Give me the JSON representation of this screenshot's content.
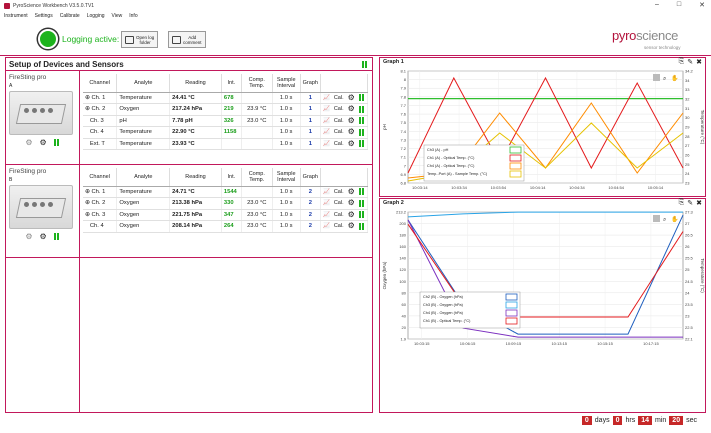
{
  "window": {
    "title": "PyroScience Workbench V3.5.0.TV1",
    "controls": [
      "–",
      "□",
      "✕"
    ]
  },
  "menu": [
    "Instrument",
    "Settings",
    "Calibrate",
    "Logging",
    "View",
    "Info"
  ],
  "logging": {
    "status_text": "Logging active:",
    "open_folder": [
      "Open log",
      "folder"
    ],
    "add_comment": [
      "Add",
      "comment"
    ]
  },
  "brand": {
    "name_a": "pyro",
    "name_b": "science",
    "tagline": "sensor technology",
    "color": "#b3123b"
  },
  "setup": {
    "title": "Setup of Devices and Sensors",
    "columns": [
      "Channel",
      "Analyte",
      "Reading",
      "Int.",
      "Comp. Temp.",
      "Sample Interval",
      "Graph"
    ],
    "devices": [
      {
        "name": "FireSting pro",
        "letter": "A",
        "rows": [
          {
            "channel": "Ch. 1",
            "expand": true,
            "analyte": "Temperature",
            "reading": "24.41 °C",
            "int": "678",
            "comp": "",
            "interval": "1.0 s",
            "graph": "1"
          },
          {
            "channel": "Ch. 2",
            "expand": true,
            "analyte": "Oxygen",
            "reading": "217.24 hPa",
            "int": "219",
            "comp": "23.9 °C",
            "interval": "1.0 s",
            "graph": "1"
          },
          {
            "channel": "Ch. 3",
            "expand": false,
            "analyte": "pH",
            "reading": "7.78 pH",
            "int": "326",
            "comp": "23.0 °C",
            "interval": "1.0 s",
            "graph": "1"
          },
          {
            "channel": "Ch. 4",
            "expand": false,
            "analyte": "Temperature",
            "reading": "22.90 °C",
            "int": "1158",
            "comp": "",
            "interval": "1.0 s",
            "graph": "1"
          },
          {
            "channel": "Ext. T",
            "expand": false,
            "analyte": "Temperature",
            "reading": "23.93 °C",
            "int": "",
            "comp": "",
            "interval": "1.0 s",
            "graph": "1"
          }
        ]
      },
      {
        "name": "FireSting pro",
        "letter": "B",
        "rows": [
          {
            "channel": "Ch. 1",
            "expand": true,
            "analyte": "Temperature",
            "reading": "24.71 °C",
            "int": "1544",
            "comp": "",
            "interval": "1.0 s",
            "graph": "2"
          },
          {
            "channel": "Ch. 2",
            "expand": true,
            "analyte": "Oxygen",
            "reading": "213.38 hPa",
            "int": "330",
            "comp": "23.0 °C",
            "interval": "1.0 s",
            "graph": "2"
          },
          {
            "channel": "Ch. 3",
            "expand": true,
            "analyte": "Oxygen",
            "reading": "221.75 hPa",
            "int": "347",
            "comp": "23.0 °C",
            "interval": "1.0 s",
            "graph": "2"
          },
          {
            "channel": "Ch. 4",
            "expand": false,
            "analyte": "Oxygen",
            "reading": "208.14 hPa",
            "int": "264",
            "comp": "23.0 °C",
            "interval": "1.0 s",
            "graph": "2"
          }
        ]
      }
    ],
    "cal_label": "Cal."
  },
  "graph1": {
    "title": "Graph 1",
    "ylabel": "pH",
    "y2label": "Temperature (°C)",
    "yticks": [
      "8.1",
      "8",
      "7.9",
      "7.8",
      "7.7",
      "7.6",
      "7.5",
      "7.4",
      "7.3",
      "7.2",
      "7.1",
      "7",
      "6.9",
      "6.8"
    ],
    "y2ticks": [
      "34.2",
      "34",
      "33",
      "32",
      "31",
      "30",
      "29",
      "28",
      "27",
      "26",
      "25",
      "24",
      "23"
    ],
    "xticks": [
      "10:03:14",
      "10:03:34",
      "10:03:54",
      "10:04:14",
      "10:04:34",
      "10:04:54",
      "10:05:14"
    ],
    "legend": [
      {
        "label": "Ch3 (A) - pH",
        "color": "#2fbf2f"
      },
      {
        "label": "Ch1 (A) - Optical Temp. (°C)",
        "color": "#e41a1c"
      },
      {
        "label": "Ch4 (A) - Optical Temp. (°C)",
        "color": "#ff8c00"
      },
      {
        "label": "Temp.-Port (A) - Sample Temp. (°C)",
        "color": "#e6c200"
      }
    ]
  },
  "graph2": {
    "title": "Graph 2",
    "ylabel": "Oxygen (hPa)",
    "y2label": "Temperature (°C)",
    "yticks": [
      "213.2",
      "200",
      "180",
      "160",
      "140",
      "120",
      "100",
      "80",
      "60",
      "40",
      "20",
      "1.9"
    ],
    "y2ticks": [
      "27.3",
      "27",
      "26.5",
      "26",
      "25.5",
      "25",
      "24.5",
      "24",
      "23.5",
      "23",
      "22.5",
      "22.1"
    ],
    "xticks": [
      "10:03:15",
      "10:06:15",
      "10:09:15",
      "10:13:15",
      "10:15:15",
      "10:17:15"
    ],
    "legend": [
      {
        "label": "Ch2 (B) - Oxygen (hPa)",
        "color": "#1f5fbf"
      },
      {
        "label": "Ch3 (B) - Oxygen (hPa)",
        "color": "#29a3e6"
      },
      {
        "label": "Ch4 (B) - Oxygen (hPa)",
        "color": "#7b2fbf"
      },
      {
        "label": "Ch1 (B) - Optical Temp. (°C)",
        "color": "#e41a1c"
      }
    ]
  },
  "timer": {
    "days": "0",
    "days_label": "days",
    "hrs": "0",
    "hrs_label": "hrs",
    "min": "14",
    "min_label": "min",
    "sec": "20",
    "sec_label": "sec"
  },
  "chart_data": [
    {
      "type": "line",
      "title": "Graph 1",
      "ylabel": "pH",
      "y2label": "Temperature (°C)",
      "ylim": [
        6.8,
        8.1
      ],
      "y2lim": [
        23,
        34.2
      ],
      "x": [
        "10:03:14",
        "10:03:34",
        "10:03:54",
        "10:04:14",
        "10:04:34",
        "10:04:54",
        "10:05:14"
      ],
      "series": [
        {
          "name": "Ch3 (A) - pH",
          "values": [
            7.78,
            7.78,
            7.78,
            7.78,
            7.78,
            7.78,
            7.78
          ]
        },
        {
          "name": "Ch1 (A) - Optical Temp. (°C)",
          "values": [
            24,
            33.5,
            25,
            33.5,
            24.5,
            33,
            24.5
          ]
        },
        {
          "name": "Ch4 (A) - Optical Temp. (°C)",
          "values": [
            23.5,
            24,
            30,
            24.5,
            31,
            24,
            30
          ]
        },
        {
          "name": "Temp.-Port (A) - Sample Temp. (°C)",
          "values": [
            23.2,
            24,
            28,
            24.5,
            29,
            24.5,
            28
          ]
        }
      ]
    },
    {
      "type": "line",
      "title": "Graph 2",
      "ylabel": "Oxygen (hPa)",
      "y2label": "Temperature (°C)",
      "ylim": [
        1.9,
        213.2
      ],
      "y2lim": [
        22.1,
        27.3
      ],
      "x": [
        "10:03:15",
        "10:06:15",
        "10:09:15",
        "10:13:15",
        "10:15:15",
        "10:17:15"
      ],
      "series": [
        {
          "name": "Ch2 (B) - Oxygen (hPa)",
          "values": [
            200,
            60,
            10,
            10,
            10,
            208
          ]
        },
        {
          "name": "Ch3 (B) - Oxygen (hPa)",
          "values": [
            205,
            210,
            213,
            213,
            213,
            213
          ]
        },
        {
          "name": "Ch4 (B) - Oxygen (hPa)",
          "values": [
            200,
            20,
            5,
            5,
            5,
            5
          ]
        },
        {
          "name": "Ch1 (B) - Optical Temp. (°C)",
          "values": [
            26.8,
            23.5,
            23,
            23,
            23,
            26.5
          ]
        }
      ]
    }
  ]
}
